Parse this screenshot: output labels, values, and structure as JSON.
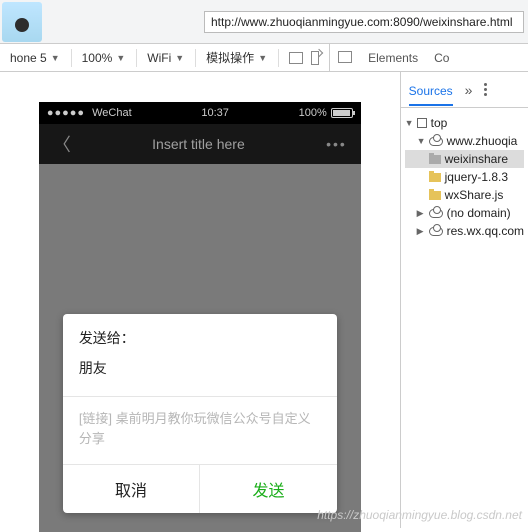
{
  "url": "http://www.zhuoqianmingyue.com:8090/weixinshare.html",
  "deviceToolbar": {
    "device": "hone 5",
    "zoom": "100%",
    "network": "WiFi",
    "mode": "模拟操作"
  },
  "devtoolsTabs": {
    "elements": "Elements",
    "co": "Co"
  },
  "phone": {
    "carrier": "WeChat",
    "time": "10:37",
    "battery": "100%",
    "title": "Insert title here"
  },
  "dialog": {
    "sendToLabel": "发送给：",
    "recipient": "朋友",
    "message": "[链接] 桌前明月教你玩微信公众号自定义分享",
    "cancel": "取消",
    "send": "发送"
  },
  "sourcesPanel": {
    "tab": "Sources",
    "tree": {
      "top": "top",
      "domain1": "www.zhuoqia",
      "file1": "weixinshare",
      "file2": "jquery-1.8.3",
      "file3": "wxShare.js",
      "nodomain": "(no domain)",
      "domain2": "res.wx.qq.com"
    }
  },
  "watermark": "https://zhuoqianmingyue.blog.csdn.net"
}
